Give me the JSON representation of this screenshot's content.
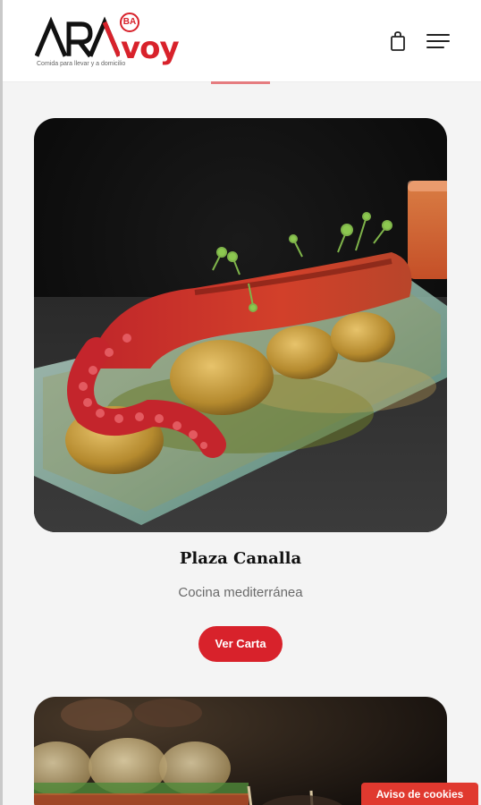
{
  "brand": {
    "logo_main": "ARA",
    "logo_accent": "voy",
    "logo_badge": "BA",
    "tagline": "Comida para llevar y a domicilio",
    "accent_color": "#d8222b"
  },
  "header": {
    "cart_icon": "shopping-bag-icon",
    "menu_icon": "hamburger-menu-icon"
  },
  "restaurants": [
    {
      "name": "Plaza Canalla",
      "cuisine": "Cocina mediterránea",
      "cta_label": "Ver Carta",
      "image_subject": "octopus-dish-photo"
    },
    {
      "image_subject": "tapas-photo"
    }
  ],
  "cookie_notice": {
    "label": "Aviso de cookies"
  }
}
